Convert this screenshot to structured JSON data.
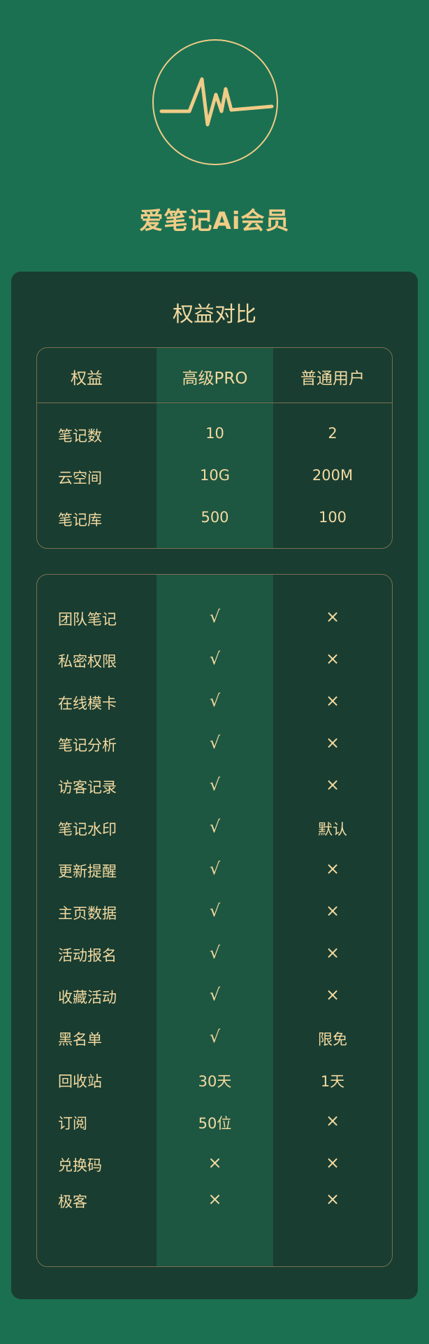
{
  "app_title": "爱笔记Ai会员",
  "comparison_title": "权益对比",
  "columns": {
    "benefit": "权益",
    "pro": "高级PRO",
    "basic": "普通用户"
  },
  "quota_rows": [
    {
      "name": "笔记数",
      "pro": "10",
      "basic": "2"
    },
    {
      "name": "云空间",
      "pro": "10G",
      "basic": "200M"
    },
    {
      "name": "笔记库",
      "pro": "500",
      "basic": "100"
    }
  ],
  "feature_rows": [
    {
      "name": "团队笔记",
      "pro": "√",
      "basic": "×"
    },
    {
      "name": "私密权限",
      "pro": "√",
      "basic": "×"
    },
    {
      "name": "在线模卡",
      "pro": "√",
      "basic": "×"
    },
    {
      "name": "笔记分析",
      "pro": "√",
      "basic": "×"
    },
    {
      "name": "访客记录",
      "pro": "√",
      "basic": "×"
    },
    {
      "name": "笔记水印",
      "pro": "√",
      "basic": "默认"
    },
    {
      "name": "更新提醒",
      "pro": "√",
      "basic": "×"
    },
    {
      "name": "主页数据",
      "pro": "√",
      "basic": "×"
    },
    {
      "name": "活动报名",
      "pro": "√",
      "basic": "×"
    },
    {
      "name": "收藏活动",
      "pro": "√",
      "basic": "×"
    },
    {
      "name": "黑名单",
      "pro": "√",
      "basic": "限免"
    },
    {
      "name": "回收站",
      "pro": "30天",
      "basic": "1天"
    },
    {
      "name": "订阅",
      "pro": "50位",
      "basic": "×"
    },
    {
      "name": "兑换码",
      "pro": "×",
      "basic": "×"
    },
    {
      "name": "极客",
      "pro": "×",
      "basic": "×"
    }
  ],
  "colors": {
    "background": "#1b7052",
    "panel": "#193d31",
    "pro_column": "#1d5641",
    "gold": "#f0cc86"
  },
  "icons": {
    "logo": "heartbeat-pulse-icon"
  }
}
